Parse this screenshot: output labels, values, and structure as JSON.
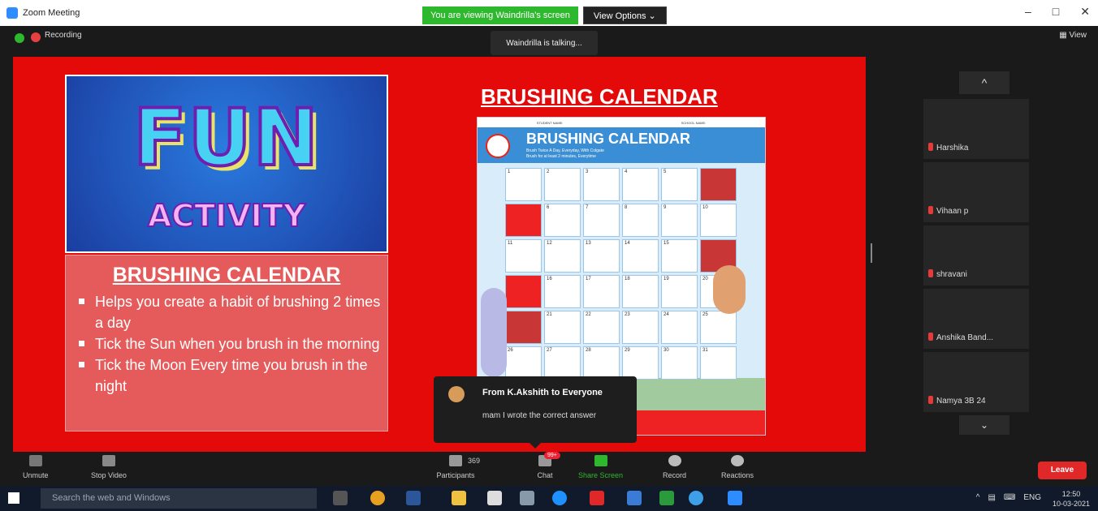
{
  "window": {
    "title": "Zoom Meeting",
    "banner_viewing": "You are viewing Waindrilla's screen",
    "view_options": "View Options ⌄",
    "minimize": "–",
    "maximize": "□",
    "close": "✕"
  },
  "topbar": {
    "recording": "Recording",
    "talking": "Waindrilla is talking...",
    "view": "View"
  },
  "slide": {
    "fun": "FUN",
    "activity": "ACTIVITY",
    "info_heading": "BRUSHING CALENDAR",
    "bullets": [
      "Helps you create a habit of brushing 2 times a day",
      "Tick the Sun when you brush in the morning",
      "Tick the Moon Every time you brush in the night"
    ],
    "right_title": "BRUSHING CALENDAR",
    "calendar": {
      "student_label": "STUDENT NAME:",
      "school_label": "SCHOOL NAME:",
      "title": "BRUSHING CALENDAR",
      "sub1": "Brush Twice A Day, Everyday, With Colgate",
      "sub2": "Brush for at least 2 minutes, Everytime"
    }
  },
  "chat_toast": {
    "from": "From K.Akshith to Everyone",
    "message": "mam I wrote the correct answer"
  },
  "gallery": {
    "up": "^",
    "down": "⌄",
    "participants": [
      "Harshika",
      "Vihaan p",
      "shravani",
      "Anshika Band...",
      "Namya 3B 24"
    ]
  },
  "toolbar": {
    "unmute": "Unmute",
    "stop_video": "Stop Video",
    "participants": "Participants",
    "participants_count": "369",
    "chat": "Chat",
    "chat_badge": "99+",
    "share_screen": "Share Screen",
    "record": "Record",
    "reactions": "Reactions",
    "leave": "Leave"
  },
  "taskbar": {
    "search_placeholder": "Search the web and Windows",
    "tray_lang": "ENG",
    "time": "12:50",
    "date": "10-03-2021"
  }
}
